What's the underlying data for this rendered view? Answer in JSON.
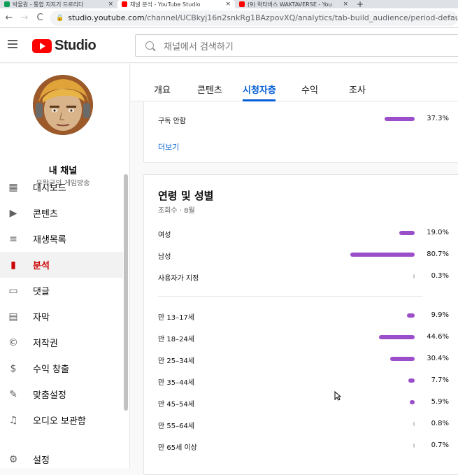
{
  "browser": {
    "tabs": [
      {
        "title": "박물원 - 통합 지지기 드로리다",
        "color": "#0f9d58"
      },
      {
        "title": "채널 분석 - YouTube Studio",
        "color": "#ff0000"
      },
      {
        "title": "(9) 왁타버스 WAKTAVERSE - You",
        "color": "#ff0000"
      }
    ],
    "new_tab": "+",
    "close_glyph": "×",
    "nav": {
      "back": "←",
      "forward": "→",
      "reload": "C"
    },
    "url_host": "studio.youtube.com",
    "url_path": "/channel/UCBkyj16n2snkRg1BAzpovXQ/analytics/tab-build_audience/period-default"
  },
  "header": {
    "logo_text": "Studio",
    "search_placeholder": "채널에서 검색하기"
  },
  "sidebar": {
    "channel_name": "내 채널",
    "channel_sub": "우왁굳의 게임방송",
    "items": [
      {
        "label": "대시보드",
        "icon": "dashboard-icon",
        "glyph": "▦",
        "active": false
      },
      {
        "label": "콘텐츠",
        "icon": "content-icon",
        "glyph": "▶",
        "active": false
      },
      {
        "label": "재생목록",
        "icon": "playlist-icon",
        "glyph": "≡",
        "active": false
      },
      {
        "label": "분석",
        "icon": "analytics-icon",
        "glyph": "▮",
        "active": true
      },
      {
        "label": "댓글",
        "icon": "comments-icon",
        "glyph": "▭",
        "active": false
      },
      {
        "label": "자막",
        "icon": "subtitles-icon",
        "glyph": "▤",
        "active": false
      },
      {
        "label": "저작권",
        "icon": "copyright-icon",
        "glyph": "©",
        "active": false
      },
      {
        "label": "수익 창출",
        "icon": "monetization-icon",
        "glyph": "$",
        "active": false
      },
      {
        "label": "맞춤설정",
        "icon": "customization-icon",
        "glyph": "✎",
        "active": false
      },
      {
        "label": "오디오 보관함",
        "icon": "audio-library-icon",
        "glyph": "♫",
        "active": false
      }
    ],
    "settings": {
      "label": "설정",
      "icon": "settings-icon",
      "glyph": "⚙"
    }
  },
  "subtabs": [
    {
      "label": "개요",
      "active": false
    },
    {
      "label": "콘텐츠",
      "active": false
    },
    {
      "label": "시청자층",
      "active": true
    },
    {
      "label": "수익",
      "active": false
    },
    {
      "label": "조사",
      "active": false
    }
  ],
  "subscription_card": {
    "rows": [
      {
        "label": "구독 안함",
        "pct": "37.3%",
        "value": 37.3
      }
    ],
    "more_link": "더보기"
  },
  "age_gender_card": {
    "title": "연령 및 성별",
    "subtitle": "조회수 · 8월",
    "bar_color": "#9b4ec9",
    "gender": [
      {
        "label": "여성",
        "pct": "19.0%",
        "value": 19.0
      },
      {
        "label": "남성",
        "pct": "80.7%",
        "value": 80.7
      },
      {
        "label": "사용자가 지정",
        "pct": "0.3%",
        "value": 0.3
      }
    ],
    "age": [
      {
        "label": "만 13–17세",
        "pct": "9.9%",
        "value": 9.9
      },
      {
        "label": "만 18–24세",
        "pct": "44.6%",
        "value": 44.6
      },
      {
        "label": "만 25–34세",
        "pct": "30.4%",
        "value": 30.4
      },
      {
        "label": "만 35–44세",
        "pct": "7.7%",
        "value": 7.7
      },
      {
        "label": "만 45–54세",
        "pct": "5.9%",
        "value": 5.9
      },
      {
        "label": "만 55–64세",
        "pct": "0.8%",
        "value": 0.8
      },
      {
        "label": "만 65세 이상",
        "pct": "0.7%",
        "value": 0.7
      }
    ]
  }
}
